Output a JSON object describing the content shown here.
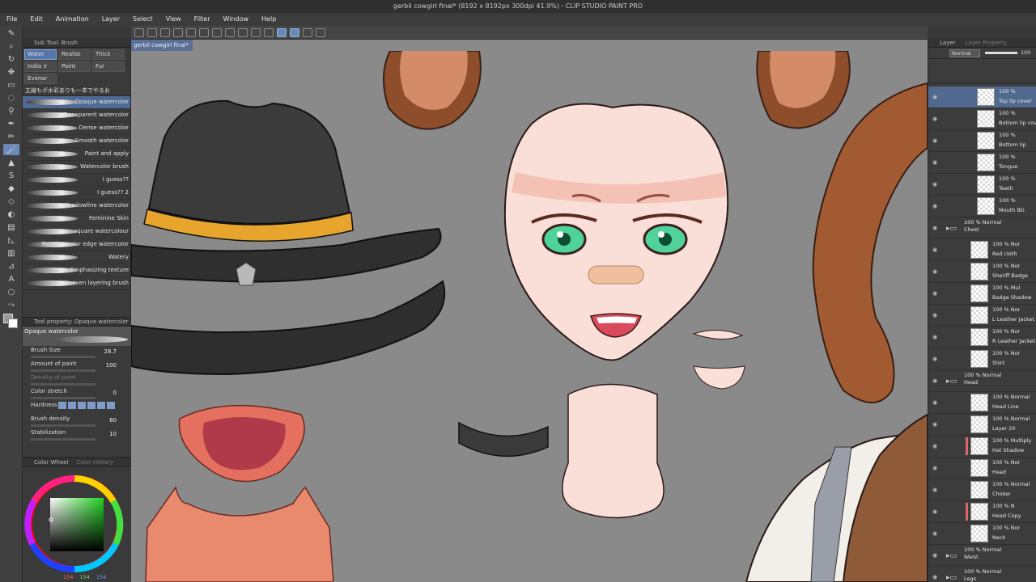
{
  "title": "gerbil cowgirl final* (8192 x 8192px 300dpi 41.9%) - CLIP STUDIO PAINT PRO",
  "menu": [
    "File",
    "Edit",
    "Animation",
    "Layer",
    "Select",
    "View",
    "Filter",
    "Window",
    "Help"
  ],
  "subtool": {
    "header": "Sub Tool: Brush",
    "groups": [
      "Water",
      "Realist",
      "Thick",
      "India ir",
      "Paint",
      "Fur",
      "Evenar"
    ],
    "selected_group": "Water",
    "set_name": "主線もポ水彩ありも一本でやるお",
    "brushes": [
      "Opaque watercolor",
      "Transparent watercolor",
      "Dense watercolor",
      "Smooth watercolor",
      "Paint and apply",
      "Watercolor brush",
      "I guess??",
      "I guess?? 2",
      "Shadowline watercolor",
      "Feminine Skin",
      "square watercolour",
      "Running color edge watercolor",
      "Watery",
      "Emphasizing texture",
      "Uneven layering brush"
    ],
    "selected_brush": "Opaque watercolor"
  },
  "toolprop": {
    "header": "Tool property: Opaque watercolor",
    "current": "Opaque watercolor",
    "brush_size_label": "Brush Size",
    "brush_size": "28.7",
    "amount_label": "Amount of paint",
    "amount": "100",
    "density_label": "Density of paint",
    "stretch_label": "Color stretch",
    "stretch": "0",
    "hardness_label": "Hardness",
    "brush_density_label": "Brush density",
    "brush_density": "60",
    "stabilization_label": "Stabilization",
    "stabilization": "10"
  },
  "color": {
    "tab1": "Color Wheel",
    "tab2": "Color History",
    "r": "154",
    "g": "154",
    "b": "154",
    "current_hex": "#9a9a9a"
  },
  "doc_tab": "gerbil cowgirl final*",
  "layers_panel": {
    "tab1": "Layer",
    "tab2": "Layer Property",
    "blend": "Normal",
    "opacity": "100",
    "rows": [
      {
        "mode": "100 %",
        "name": "Top lip cover",
        "type": "layer",
        "sel": true
      },
      {
        "mode": "100 %",
        "name": "Bottom lip cover",
        "type": "layer"
      },
      {
        "mode": "100 %",
        "name": "Bottom lip",
        "type": "layer"
      },
      {
        "mode": "100 %",
        "name": "Tongue",
        "type": "layer"
      },
      {
        "mode": "100 %",
        "name": "Teeth",
        "type": "layer"
      },
      {
        "mode": "100 %",
        "name": "Mouth BG",
        "type": "layer"
      },
      {
        "mode": "100 % Normal",
        "name": "Chest",
        "type": "folder"
      },
      {
        "mode": "100 % Nor",
        "name": "Red cloth",
        "type": "layer"
      },
      {
        "mode": "100 % Nor",
        "name": "Sheriff Badge",
        "type": "layer"
      },
      {
        "mode": "100 % Mul",
        "name": "Badge Shadow",
        "type": "layer"
      },
      {
        "mode": "100 % Nor",
        "name": "L Leather Jacket",
        "type": "layer"
      },
      {
        "mode": "100 % Nor",
        "name": "R Leather Jacket",
        "type": "layer"
      },
      {
        "mode": "100 % Nor",
        "name": "Shirt",
        "type": "layer"
      },
      {
        "mode": "100 % Normal",
        "name": "Head",
        "type": "folder"
      },
      {
        "mode": "100 % Normal",
        "name": "Head Line",
        "type": "layer"
      },
      {
        "mode": "100 % Normal",
        "name": "Layer 20",
        "type": "layer"
      },
      {
        "mode": "100 % Multiply",
        "name": "Hat Shadow",
        "type": "layer",
        "red": true
      },
      {
        "mode": "100 % Nor",
        "name": "Head",
        "type": "layer"
      },
      {
        "mode": "100 % Normal",
        "name": "Choker",
        "type": "layer"
      },
      {
        "mode": "100 % N",
        "name": "Head Copy",
        "type": "layer",
        "red": true
      },
      {
        "mode": "100 % Nor",
        "name": "Neck",
        "type": "layer"
      },
      {
        "mode": "100 % Normal",
        "name": "Waist",
        "type": "folder"
      },
      {
        "mode": "100 % Normal",
        "name": "Legs",
        "type": "folder"
      },
      {
        "mode": "100 % Normal",
        "name": "",
        "type": "folder"
      }
    ]
  }
}
